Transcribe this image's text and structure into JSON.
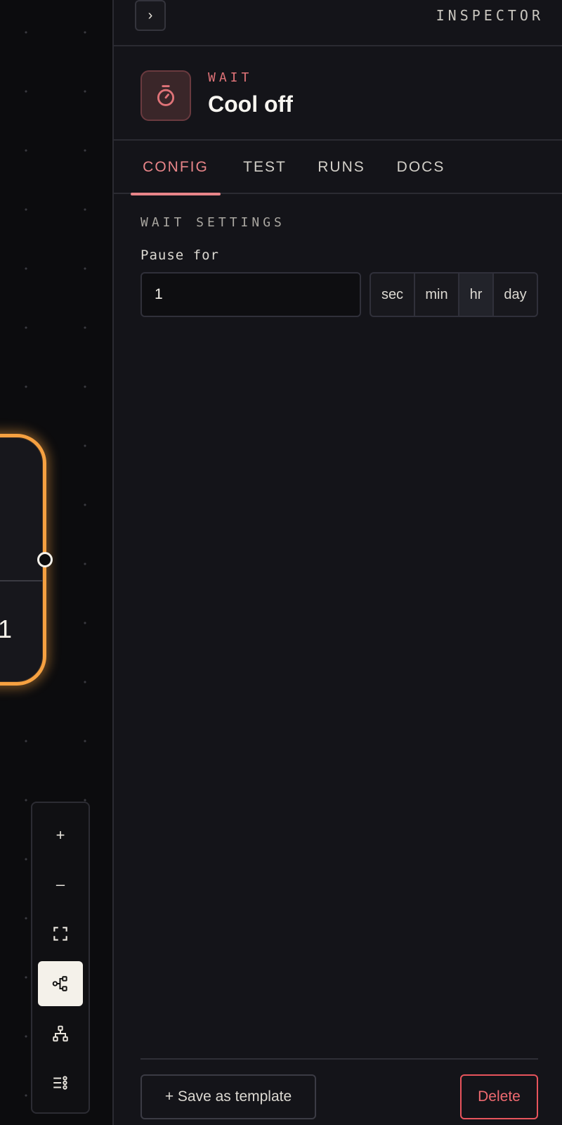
{
  "canvas": {
    "node_value": "1",
    "controls": [
      {
        "name": "zoom-in-button",
        "icon": "plus-icon",
        "glyph": "+"
      },
      {
        "name": "zoom-out-button",
        "icon": "minus-icon",
        "glyph": "–"
      },
      {
        "name": "fit-view-button",
        "icon": "fit-view-icon"
      },
      {
        "name": "horizontal-layout-button",
        "icon": "horizontal-layout-icon",
        "active": true
      },
      {
        "name": "vertical-layout-button",
        "icon": "vertical-layout-icon"
      },
      {
        "name": "list-view-button",
        "icon": "list-view-icon"
      }
    ]
  },
  "inspector": {
    "title": "INSPECTOR",
    "collapse_glyph": "›",
    "node": {
      "kind": "WAIT",
      "name": "Cool off",
      "icon": "timer-icon"
    },
    "tabs": [
      {
        "label": "CONFIG",
        "active": true
      },
      {
        "label": "TEST",
        "active": false
      },
      {
        "label": "RUNS",
        "active": false
      },
      {
        "label": "DOCS",
        "active": false
      }
    ],
    "section_label": "WAIT SETTINGS",
    "pause_label": "Pause for",
    "pause_value": "1",
    "units": [
      {
        "label": "sec",
        "selected": false
      },
      {
        "label": "min",
        "selected": false
      },
      {
        "label": "hr",
        "selected": true
      },
      {
        "label": "day",
        "selected": false
      }
    ],
    "save_template_label": "+ Save as template",
    "delete_label": "Delete"
  },
  "colors": {
    "accent": "#e88589",
    "node_border": "#f6a141",
    "danger": "#e8545c",
    "background": "#141419"
  }
}
